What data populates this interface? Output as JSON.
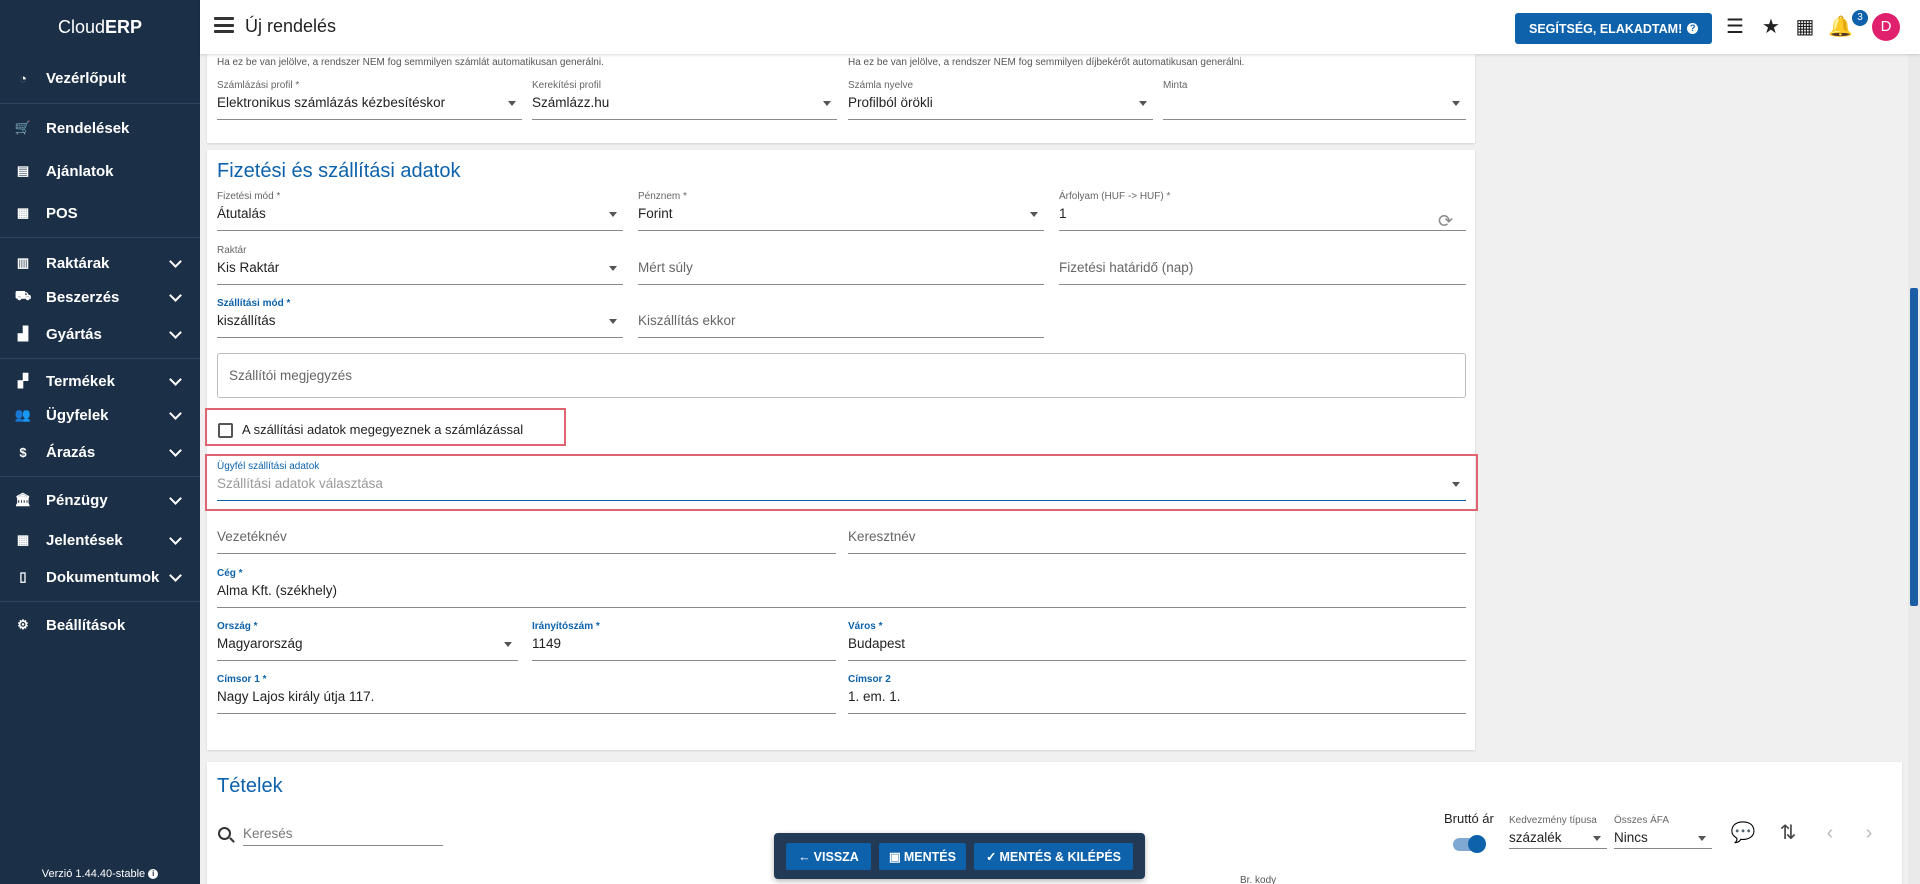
{
  "app": {
    "brand_light": "Cloud",
    "brand_bold": "ERP",
    "version": "Verzió 1.44.40-stable"
  },
  "sidebar": {
    "items": [
      {
        "label": "Vezérlőpult",
        "icon": "pie-chart-icon"
      },
      {
        "label": "Rendelések",
        "icon": "cart-icon"
      },
      {
        "label": "Ajánlatok",
        "icon": "document-icon"
      },
      {
        "label": "POS",
        "icon": "cash-register-icon"
      },
      {
        "label": "Raktárak",
        "icon": "warehouse-icon"
      },
      {
        "label": "Beszerzés",
        "icon": "truck-icon"
      },
      {
        "label": "Gyártás",
        "icon": "factory-icon"
      },
      {
        "label": "Termékek",
        "icon": "boxes-icon"
      },
      {
        "label": "Ügyfelek",
        "icon": "users-icon"
      },
      {
        "label": "Árazás",
        "icon": "dollar-icon"
      },
      {
        "label": "Pénzügy",
        "icon": "bank-icon"
      },
      {
        "label": "Jelentések",
        "icon": "table-icon"
      },
      {
        "label": "Dokumentumok",
        "icon": "file-icon"
      },
      {
        "label": "Beállítások",
        "icon": "gear-icon"
      }
    ]
  },
  "header": {
    "title": "Új rendelés",
    "help_label": "SEGÍTSÉG, ELAKADTAM!",
    "notification_count": "3",
    "avatar_initial": "D"
  },
  "invoice_section": {
    "note_left": "Ha ez be van jelölve, a rendszer NEM fog semmilyen számlát automatikusan generálni.",
    "note_right": "Ha ez be van jelölve, a rendszer NEM fog semmilyen díjbekérőt automatikusan generálni.",
    "billing_profile": {
      "label": "Számlázási profil *",
      "value": "Elektronikus számlázás kézbesítéskor"
    },
    "rounding_profile": {
      "label": "Kerekítési profil",
      "value": "Számlázz.hu"
    },
    "invoice_language": {
      "label": "Számla nyelve",
      "value": "Profilból örökli"
    },
    "template": {
      "label": "Minta",
      "value": ""
    }
  },
  "payment_section": {
    "title": "Fizetési és szállítási adatok",
    "payment_method": {
      "label": "Fizetési mód *",
      "value": "Átutalás"
    },
    "currency": {
      "label": "Pénznem *",
      "value": "Forint"
    },
    "exchange_rate": {
      "label": "Árfolyam (HUF -> HUF) *",
      "value": "1"
    },
    "warehouse": {
      "label": "Raktár",
      "value": "Kis Raktár"
    },
    "measured_weight": {
      "placeholder": "Mért súly"
    },
    "payment_deadline": {
      "placeholder": "Fizetési határidő (nap)"
    },
    "shipping_method": {
      "label": "Szállítási mód *",
      "value": "kiszállítás"
    },
    "shipping_when": {
      "placeholder": "Kiszállítás ekkor"
    },
    "shipping_note": {
      "placeholder": "Szállítói megjegyzés"
    },
    "same_as_billing_label": "A szállítási adatok megegyeznek a számlázással",
    "customer_shipping": {
      "label": "Ügyfél szállítási adatok",
      "placeholder": "Szállítási adatok választása"
    },
    "last_name": {
      "placeholder": "Vezetéknév"
    },
    "first_name": {
      "placeholder": "Keresztnév"
    },
    "company": {
      "label": "Cég *",
      "value": "Alma Kft. (székhely)"
    },
    "country": {
      "label": "Ország *",
      "value": "Magyarország"
    },
    "zip": {
      "label": "Irányítószám *",
      "value": "1149"
    },
    "city": {
      "label": "Város *",
      "value": "Budapest"
    },
    "address1": {
      "label": "Címsor 1 *",
      "value": "Nagy Lajos király útja 117."
    },
    "address2": {
      "label": "Címsor 2",
      "value": "1. em. 1."
    }
  },
  "items_section": {
    "title": "Tételek",
    "search_placeholder": "Keresés",
    "gross_price_label": "Bruttó ár",
    "discount_type": {
      "label": "Kedvezmény típusa",
      "value": "százalék"
    },
    "total_vat": {
      "label": "Összes ÁFA",
      "value": "Nincs"
    },
    "code_column": "Br. kody"
  },
  "actions": {
    "back": "VISSZA",
    "save": "MENTÉS",
    "save_exit": "MENTÉS & KILÉPÉS"
  }
}
